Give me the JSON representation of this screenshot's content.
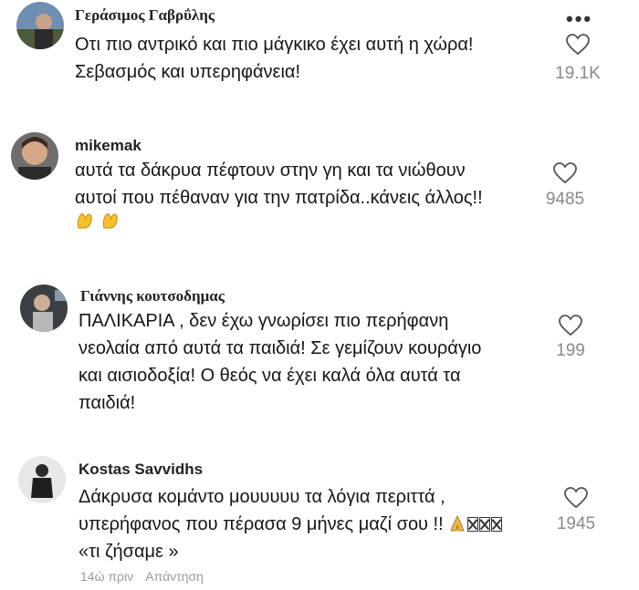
{
  "more_icon": "ellipsis-icon",
  "heart_icon": "heart-outline-icon",
  "comments": [
    {
      "username": "Γεράσιμος Γαβρΰλης",
      "text": "Οτι πιο αντρικό και πιο μάγκικο έχει αυτή η χώρα!\nΣεβασμός και υπερηφάνεια!",
      "likes": "19.1K"
    },
    {
      "username": "mikemak",
      "text": "αυτά τα δάκρυα πέφτουν στην γη και τα νιώθουν\nαυτοί που πέθαναν για την πατρίδα..κάνεις άλλος!!",
      "likes": "9485",
      "emoji": "clap-hands-icon"
    },
    {
      "username": "Γιάννης κουτσοδημας",
      "text": "ΠΑΛΙΚΑΡΙΑ , δεν έχω γνωρίσει πιο περήφανη\nνεολαία από αυτά τα παιδιά! Σε γεμίζουν κουράγιο\nκαι αισιοδοξία! Ο θεός να έχει καλά όλα αυτά τα\nπαιδιά!",
      "likes": "199"
    },
    {
      "username": "Kostas Savvidhs",
      "text_line1": "Δάκρυσα κομάντο μουυυυυ τα λόγια περιττά ,",
      "text_line2": "υπερήφανος που πέρασα 9 μήνες μαζί σου !! ",
      "text_line3": "«τι ζήσαμε »",
      "likes": "1945",
      "time": "14ώ πριν",
      "reply": "Απάντηση"
    }
  ]
}
